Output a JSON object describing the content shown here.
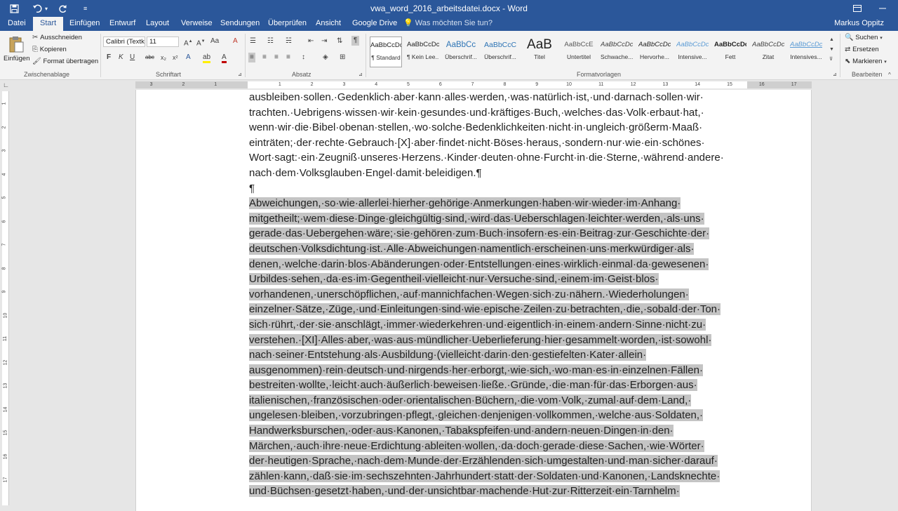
{
  "titlebar": {
    "qat": [
      "save-icon",
      "undo-icon",
      "redo-icon",
      "customize-icon"
    ],
    "title": "vwa_word_2016_arbeitsdatei.docx - Word"
  },
  "tabs": [
    "Datei",
    "Start",
    "Einfügen",
    "Entwurf",
    "Layout",
    "Verweise",
    "Sendungen",
    "Überprüfen",
    "Ansicht",
    "Google Drive"
  ],
  "tellme": "Was möchten Sie tun?",
  "user": "Markus Oppitz",
  "ribbon": {
    "clipboard": {
      "paste": "Einfügen",
      "cut": "Ausschneiden",
      "copy": "Kopieren",
      "format_painter": "Format übertragen",
      "label": "Zwischenablage"
    },
    "font": {
      "name": "Calibri (Textk",
      "size": "11",
      "label": "Schriftart",
      "bold": "F",
      "italic": "K",
      "underline": "U",
      "strike": "abc",
      "sub": "x₂",
      "sup": "x²"
    },
    "paragraph": {
      "label": "Absatz"
    },
    "styles": {
      "label": "Formatvorlagen",
      "items": [
        {
          "preview": "AaBbCcDc",
          "name": "¶ Standard"
        },
        {
          "preview": "AaBbCcDc",
          "name": "¶ Kein Lee..."
        },
        {
          "preview": "AaBbCc",
          "name": "Überschrif..."
        },
        {
          "preview": "AaBbCcC",
          "name": "Überschrif..."
        },
        {
          "preview": "AaB",
          "name": "Titel"
        },
        {
          "preview": "AaBbCcE",
          "name": "Untertitel"
        },
        {
          "preview": "AaBbCcDc",
          "name": "Schwache..."
        },
        {
          "preview": "AaBbCcDc",
          "name": "Hervorhe..."
        },
        {
          "preview": "AaBbCcDc",
          "name": "Intensive..."
        },
        {
          "preview": "AaBbCcDc",
          "name": "Fett"
        },
        {
          "preview": "AaBbCcDc",
          "name": "Zitat"
        },
        {
          "preview": "AaBbCcDc",
          "name": "Intensives..."
        }
      ]
    },
    "editing": {
      "search": "Suchen",
      "replace": "Ersetzen",
      "select": "Markieren",
      "label": "Bearbeiten"
    }
  },
  "ruler": {
    "h_numbers": [
      "3",
      "2",
      "1",
      "",
      "1",
      "2",
      "3",
      "4",
      "5",
      "6",
      "7",
      "8",
      "9",
      "10",
      "11",
      "12",
      "13",
      "14",
      "15",
      "16",
      "17"
    ],
    "v_numbers": [
      "1",
      "2",
      "3",
      "4",
      "5",
      "6",
      "7",
      "8",
      "9",
      "10",
      "11",
      "12",
      "13",
      "14",
      "15",
      "16",
      "17"
    ]
  },
  "document": {
    "para1": [
      "ausbleiben·sollen.·Gedenklich·aber·kann·alles·werden,·was·natürlich·ist,·und·darnach·sollen·wir·",
      "trachten.·Uebrigens·wissen·wir·kein·gesundes·und·kräftiges·Buch,·welches·das·Volk·erbaut·hat,·",
      "wenn·wir·die·Bibel·obenan·stellen,·wo·solche·Bedenklichkeiten·nicht·in·ungleich·größerm·Maaß·",
      "einträten;·der·rechte·Gebrauch·[X]·aber·findet·nicht·Böses·heraus,·sondern·nur·wie·ein·schönes·",
      "Wort·sagt:·ein·Zeugniß·unseres·Herzens.·Kinder·deuten·ohne·Furcht·in·die·Sterne,·während·andere·",
      "nach·dem·Volksglauben·Engel·damit·beleidigen.¶"
    ],
    "empty_para": "¶",
    "para2": [
      "Abweichungen,·so·wie·allerlei·hierher·gehörige·Anmerkungen·haben·wir·wieder·im·Anhang·",
      "mitgetheilt;·wem·diese·Dinge·gleichgültig·sind,·wird·das·Ueberschlagen·leichter·werden,·als·uns·",
      "gerade·das·Uebergehen·wäre;·sie·gehören·zum·Buch·insofern·es·ein·Beitrag·zur·Geschichte·der·",
      "deutschen·Volksdichtung·ist.·Alle·Abweichungen·namentlich·erscheinen·uns·merkwürdiger·als·",
      "denen,·welche·darin·blos·Abänderungen·oder·Entstellungen·eines·wirklich·einmal·da·gewesenen·",
      "Urbildes·sehen,·da·es·im·Gegentheil·vielleicht·nur·Versuche·sind,·einem·im·Geist·blos·",
      "vorhandenen,·unerschöpflichen,·auf·mannichfachen·Wegen·sich·zu·nähern.·Wiederholungen·",
      "einzelner·Sätze,·Züge,·und·Einleitungen·sind·wie·epische·Zeilen·zu·betrachten,·die,·sobald·der·Ton·",
      "sich·rührt,·der·sie·anschlägt,·immer·wiederkehren·und·eigentlich·in·einem·andern·Sinne·nicht·zu·",
      "verstehen.·[XI]·Alles·aber,·was·aus·mündlicher·Ueberlieferung·hier·gesammelt·worden,·ist·sowohl·",
      "nach·seiner·Entstehung·als·Ausbildung·(vielleicht·darin·den·gestiefelten·Kater·allein·",
      "ausgenommen)·rein·deutsch·und·nirgends·her·erborgt,·wie·sich,·wo·man·es·in·einzelnen·Fällen·",
      "bestreiten·wollte,·leicht·auch·äußerlich·beweisen·ließe.·Gründe,·die·man·für·das·Erborgen·aus·",
      "italienischen,·französischen·oder·orientalischen·Büchern,·die·vom·Volk,·zumal·auf·dem·Land,·",
      "ungelesen·bleiben,·vorzubringen·pflegt,·gleichen·denjenigen·vollkommen,·welche·aus·Soldaten,·",
      "Handwerksburschen,·oder·aus·Kanonen,·Tabakspfeifen·und·andern·neuen·Dingen·in·den·",
      "Märchen,·auch·ihre·neue·Erdichtung·ableiten·wollen,·da·doch·gerade·diese·Sachen,·wie·Wörter·",
      "der·heutigen·Sprache,·nach·dem·Munde·der·Erzählenden·sich·umgestalten·und·man·sicher·darauf·",
      "zählen·kann,·daß·sie·im·sechszehnten·Jahrhundert·statt·der·Soldaten·und·Kanonen,·Landsknechte·",
      "und·Büchsen·gesetzt·haben,·und·der·unsichtbar·machende·Hut·zur·Ritterzeit·ein·Tarnhelm·"
    ]
  }
}
